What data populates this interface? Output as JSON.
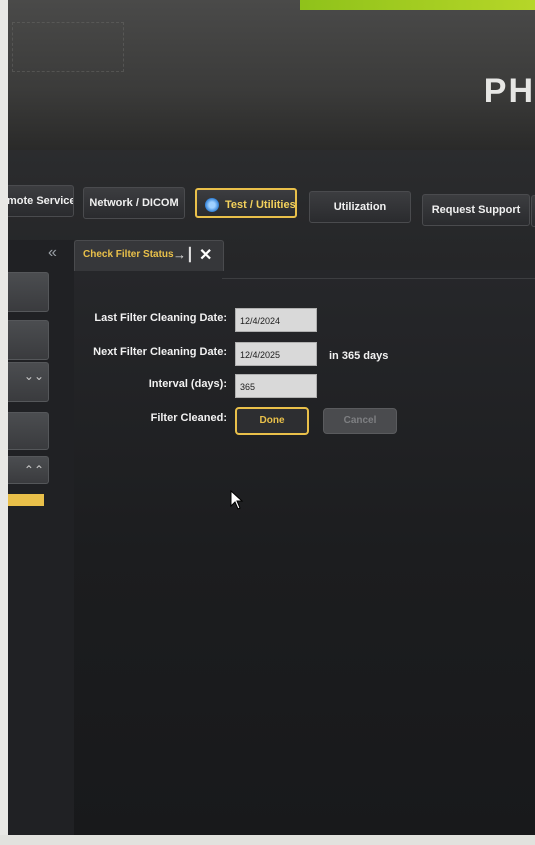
{
  "toolbar": {
    "buttons": [
      {
        "label": "mote Services"
      },
      {
        "label": "Network / DICOM"
      },
      {
        "label": "Test / Utilities"
      },
      {
        "label": "Utilization"
      },
      {
        "label": "Request Support"
      }
    ]
  },
  "bezel": {
    "brand": "PH"
  },
  "tab": {
    "label": "Check Filter Status"
  },
  "form": {
    "last_label": "Last Filter Cleaning Date:",
    "last_value": "12/4/2024",
    "next_label": "Next Filter Cleaning Date:",
    "next_value": "12/4/2025",
    "next_suffix": "in 365 days",
    "interval_label": "Interval (days):",
    "interval_value": "365",
    "cleaned_label": "Filter Cleaned:",
    "done_label": "Done",
    "cancel_label": "Cancel"
  },
  "colors": {
    "accent": "#e9c04a",
    "screen_bg": "#1d1e20"
  },
  "icons": [
    "gear-icon",
    "pin-icon",
    "close-icon",
    "collapse-left-icon",
    "chevron-down-icon",
    "chevron-up-icon",
    "mouse-cursor-icon"
  ]
}
